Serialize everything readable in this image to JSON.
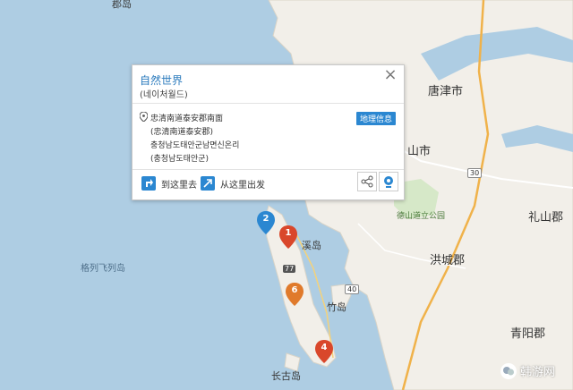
{
  "map": {
    "place_labels": {
      "dangjin": "唐津市",
      "seosan": "山市",
      "yesan": "礼山郡",
      "hongseong": "洪城郡",
      "cheongyang": "青阳郡",
      "gyeokryeolbi": "格列飞列岛",
      "anmyeon": "长古岛",
      "jukdo": "竹岛",
      "haedo": "溪岛",
      "park": "德山道立公园",
      "top_left": "郡岛"
    },
    "road_numbers": [
      "77",
      "40",
      "30"
    ]
  },
  "popup": {
    "title": "自然世界",
    "subtitle": "(네이처월드)",
    "address_lines": [
      "忠清南道泰安郡南面",
      "(忠清南道泰安郡)",
      "충청남도태안군남면신온리",
      "(충청남도태안군)"
    ],
    "geo_button": "地理信息",
    "actions": {
      "go_here": "到这里去",
      "from_here": "从这里出发"
    },
    "close": "×"
  },
  "markers": [
    "2",
    "1",
    "6",
    "4"
  ],
  "colors": {
    "sea": "#aecde3",
    "land": "#f2efe9",
    "accent": "#2b87d1",
    "marker_red": "#d9472b",
    "marker_blue": "#2b87d1"
  },
  "watermark": "韩游网"
}
